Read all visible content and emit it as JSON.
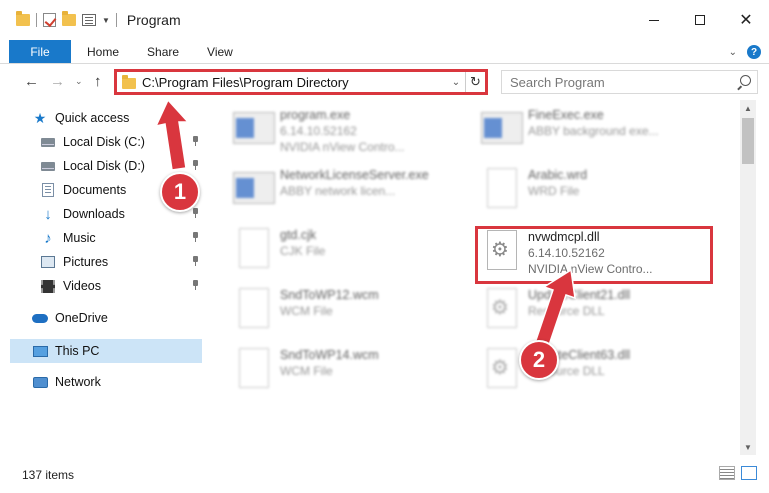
{
  "window": {
    "title": "Program",
    "min_symbol": "",
    "max_symbol": "",
    "close_symbol": "✕"
  },
  "ribbon": {
    "tabs": [
      {
        "label": "File"
      },
      {
        "label": "Home"
      },
      {
        "label": "Share"
      },
      {
        "label": "View"
      }
    ],
    "chevron": "⌄",
    "help": "?"
  },
  "address_bar": {
    "path": "C:\\Program Files\\Program Directory",
    "refresh_symbol": "↻",
    "dropdown_symbol": "⌄"
  },
  "search": {
    "placeholder": "Search Program"
  },
  "nav": {
    "back": "←",
    "forward": "→",
    "recent": "⌄",
    "up": "↑"
  },
  "sidebar": {
    "items": [
      {
        "label": "Quick access",
        "icon": "star-icon"
      },
      {
        "label": "Local Disk (C:)",
        "icon": "drive-icon",
        "pinned": true
      },
      {
        "label": "Local Disk (D:)",
        "icon": "drive-icon",
        "pinned": true
      },
      {
        "label": "Documents",
        "icon": "documents-icon",
        "pinned": true
      },
      {
        "label": "Downloads",
        "icon": "downloads-icon",
        "pinned": true
      },
      {
        "label": "Music",
        "icon": "music-icon",
        "pinned": true
      },
      {
        "label": "Pictures",
        "icon": "pictures-icon",
        "pinned": true
      },
      {
        "label": "Videos",
        "icon": "videos-icon",
        "pinned": true
      },
      {
        "label": "OneDrive",
        "icon": "onedrive-icon"
      },
      {
        "label": "This PC",
        "icon": "pc-icon",
        "selected": true
      },
      {
        "label": "Network",
        "icon": "network-icon"
      }
    ]
  },
  "files": [
    {
      "name": "program.exe",
      "line1": "6.14.10.52162",
      "line2": "NVIDIA nView Contro...",
      "icon": "exe-icon"
    },
    {
      "name": "FineExec.exe",
      "line1": "ABBY background exe...",
      "line2": "",
      "icon": "exe-icon"
    },
    {
      "name": "NetworkLicenseServer.exe",
      "line1": "ABBY network licen...",
      "line2": "",
      "icon": "exe-icon"
    },
    {
      "name": "Arabic.wrd",
      "line1": "WRD File",
      "line2": "",
      "icon": "document-icon"
    },
    {
      "name": "gtd.cjk",
      "line1": "CJK File",
      "line2": "",
      "icon": "document-icon"
    },
    {
      "name": "nvwdmcpl.dll",
      "line1": "6.14.10.52162",
      "line2": "NVIDIA nView Contro...",
      "icon": "dll-gear-icon"
    },
    {
      "name": "SndToWP12.wcm",
      "line1": "WCM File",
      "line2": "",
      "icon": "document-icon"
    },
    {
      "name": "UpdateClient21.dll",
      "line1": "Resource DLL",
      "line2": "",
      "icon": "dll-gear-icon"
    },
    {
      "name": "SndToWP14.wcm",
      "line1": "WCM File",
      "line2": "",
      "icon": "document-icon"
    },
    {
      "name": "UpdateClient63.dll",
      "line1": "Resource DLL",
      "line2": "",
      "icon": "dll-gear-icon"
    }
  ],
  "status": {
    "count": "137 items"
  },
  "annotations": {
    "step1": "1",
    "step2": "2"
  },
  "colors": {
    "accent": "#1979ca",
    "highlight": "#d9363e",
    "selected": "#cce4f7"
  }
}
